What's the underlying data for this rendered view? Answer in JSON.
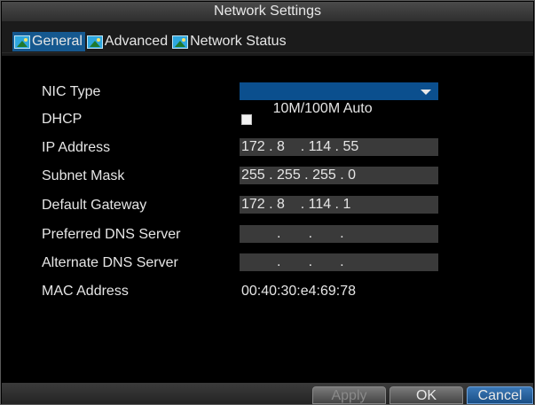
{
  "window": {
    "title": "Network Settings"
  },
  "tabs": [
    {
      "label": "General",
      "active": true
    },
    {
      "label": "Advanced",
      "active": false
    },
    {
      "label": "Network Status",
      "active": false
    }
  ],
  "form": {
    "nic_type": {
      "label": "NIC Type",
      "value": "10M/100M Auto"
    },
    "dhcp": {
      "label": "DHCP",
      "checked": false
    },
    "ip_address": {
      "label": "IP Address",
      "value": "172 . 8    . 114 . 55"
    },
    "subnet_mask": {
      "label": "Subnet Mask",
      "value": "255 . 255 . 255 . 0"
    },
    "default_gateway": {
      "label": "Default Gateway",
      "value": "172 . 8    . 114 . 1"
    },
    "preferred_dns": {
      "label": "Preferred DNS Server",
      "value": "         .       .       ."
    },
    "alternate_dns": {
      "label": "Alternate DNS Server",
      "value": "         .       .       ."
    },
    "mac_address": {
      "label": "MAC Address",
      "value": "00:40:30:e4:69:78"
    }
  },
  "buttons": {
    "apply": "Apply",
    "ok": "OK",
    "cancel": "Cancel"
  },
  "colors": {
    "active_tab": "#15588f",
    "select_field": "#0b4f8e",
    "input_field": "#3a3a3a",
    "primary_button": "#1a4f86"
  }
}
